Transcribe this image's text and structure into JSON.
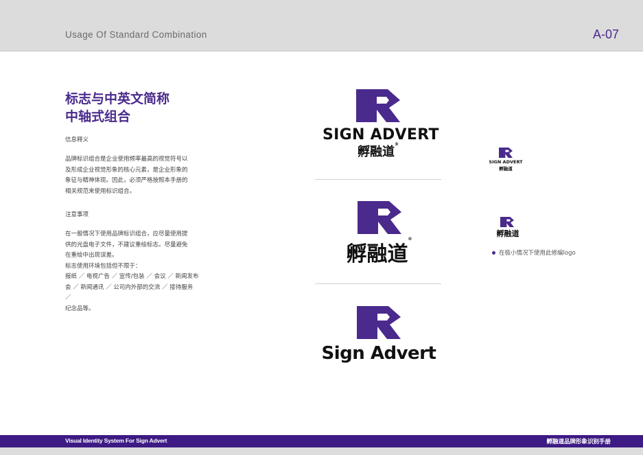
{
  "header": {
    "title": "Usage Of Standard Combination",
    "page_number": "A-07"
  },
  "content": {
    "main_title_line1": "标志与中英文简称",
    "main_title_line2": "中轴式组合",
    "section1": {
      "heading": "信息释义",
      "lines": [
        "品牌标识组合是企业使用频率最高的视觉符号以",
        "及形成企业视觉形象的核心元素，是企业形象的",
        "象征与精神体现。因此，必须严格按照本手册的",
        "相关规范来使用标识组合。"
      ]
    },
    "section2": {
      "heading": "注意事项",
      "lines": [
        "在一般情况下使用品牌标识组合，应尽量使用提",
        "供的光盘电子文件，不建议重绘标志。尽量避免",
        "在重绘中出现误差。",
        "标志使用环境包括但不限于：",
        "报纸 ／ 电视广告 ／ 宣传/包装 ／ 会议 ／ 新闻发布",
        "会 ／ 新闻通讯 ／ 公司内外部的交流 ／ 接待服务 ／",
        "纪念品等。"
      ]
    }
  },
  "logos": {
    "english": "SIGN ADVERT",
    "chinese": "孵融道",
    "english_mixed": "Sign Advert",
    "registered": "®",
    "brand_color": "#4a2a8c"
  },
  "note": {
    "text": "在极小情况下使用此修编logo"
  },
  "footer": {
    "left": "Visual Identity System For Sign Advert",
    "right": "孵融道品牌形象识别手册"
  }
}
